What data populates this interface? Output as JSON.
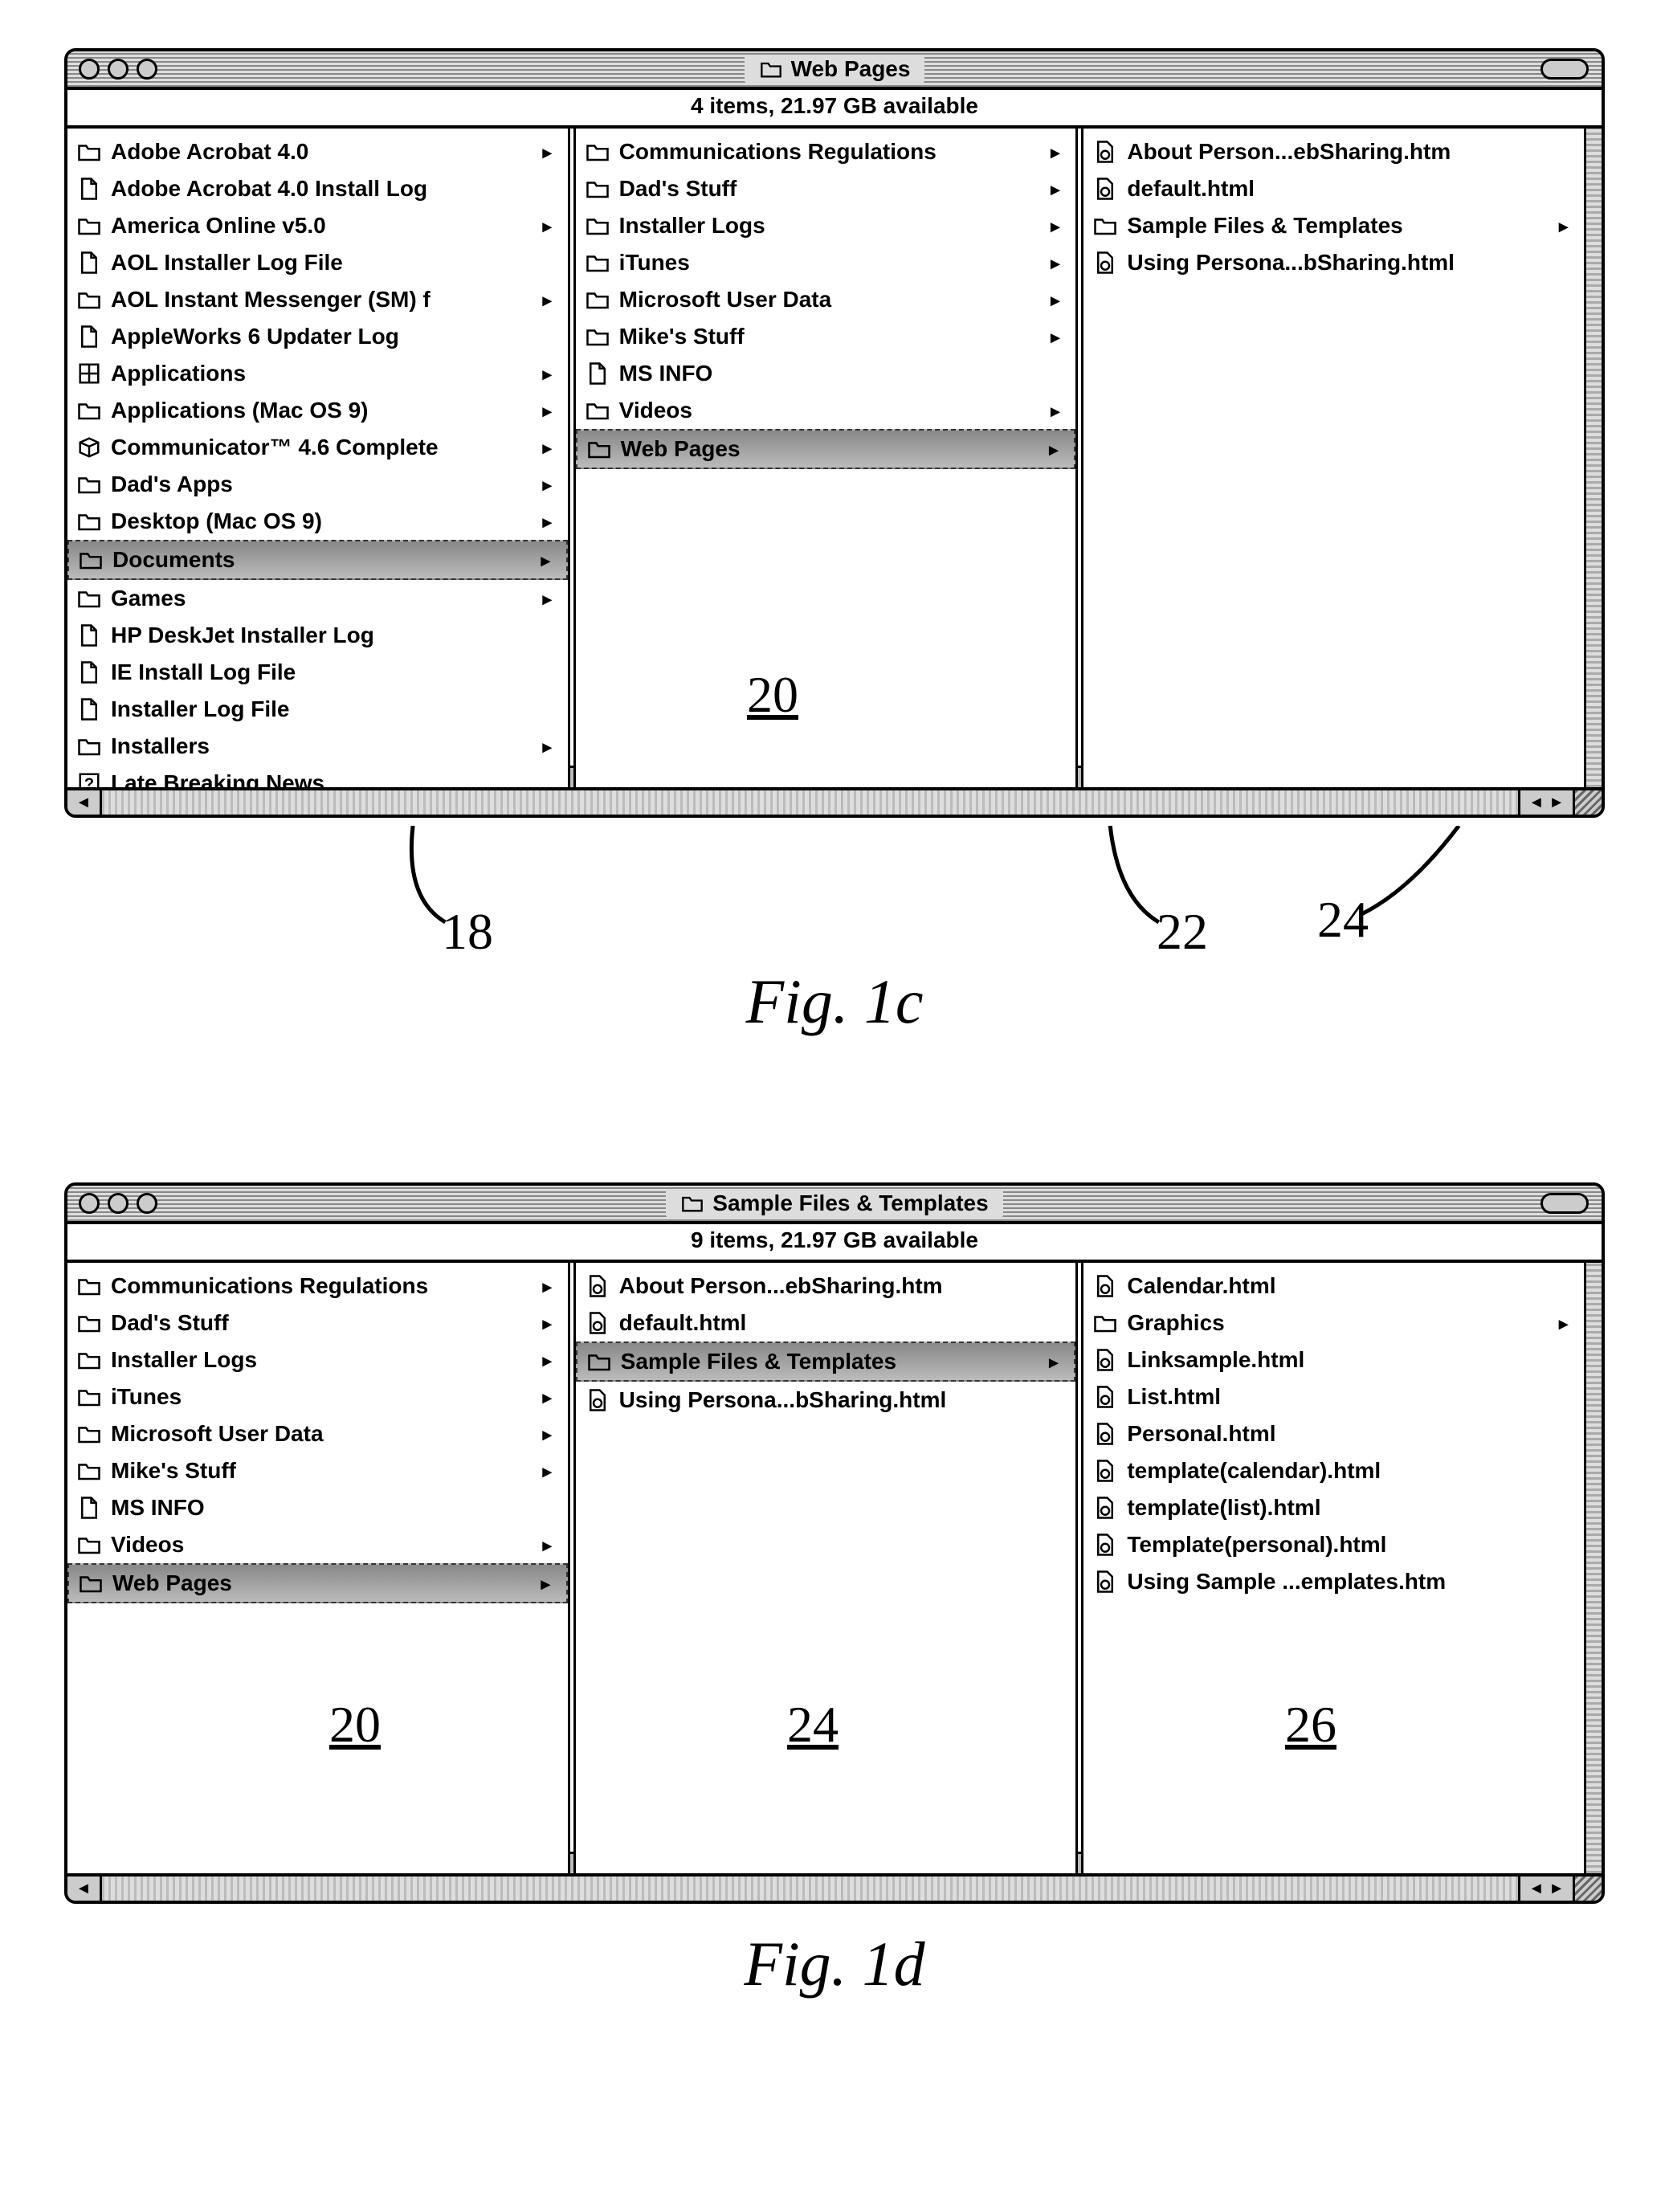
{
  "fig1c": {
    "title": "Web Pages",
    "status": "4 items, 21.97 GB available",
    "caption": "Fig. 1c",
    "callouts": {
      "a": "18",
      "b": "20",
      "c": "22",
      "d": "24"
    },
    "col1": [
      {
        "label": "Adobe Acrobat 4.0",
        "icon": "folder",
        "arrow": true
      },
      {
        "label": "Adobe Acrobat 4.0 Install Log",
        "icon": "doc",
        "arrow": false
      },
      {
        "label": "America Online v5.0",
        "icon": "folder",
        "arrow": true
      },
      {
        "label": "AOL Installer Log File",
        "icon": "doc",
        "arrow": false
      },
      {
        "label": "AOL Instant Messenger (SM) f",
        "icon": "folder",
        "arrow": true
      },
      {
        "label": "AppleWorks 6 Updater Log",
        "icon": "doc",
        "arrow": false
      },
      {
        "label": "Applications",
        "icon": "app",
        "arrow": true
      },
      {
        "label": "Applications (Mac OS 9)",
        "icon": "folder",
        "arrow": true
      },
      {
        "label": "Communicator™ 4.6 Complete",
        "icon": "pkg",
        "arrow": true
      },
      {
        "label": "Dad's Apps",
        "icon": "folder",
        "arrow": true
      },
      {
        "label": "Desktop (Mac OS 9)",
        "icon": "folder",
        "arrow": true
      },
      {
        "label": "Documents",
        "icon": "folder",
        "arrow": true,
        "selected": true
      },
      {
        "label": "Games",
        "icon": "folder",
        "arrow": true
      },
      {
        "label": "HP DeskJet Installer Log",
        "icon": "doc",
        "arrow": false
      },
      {
        "label": "IE Install Log File",
        "icon": "doc",
        "arrow": false
      },
      {
        "label": "Installer Log File",
        "icon": "doc",
        "arrow": false
      },
      {
        "label": "Installers",
        "icon": "folder",
        "arrow": true
      },
      {
        "label": "Late Breaking News",
        "icon": "help",
        "arrow": false
      }
    ],
    "col2": [
      {
        "label": "Communications Regulations",
        "icon": "folder",
        "arrow": true
      },
      {
        "label": "Dad's Stuff",
        "icon": "folder",
        "arrow": true
      },
      {
        "label": "Installer Logs",
        "icon": "folder",
        "arrow": true
      },
      {
        "label": "iTunes",
        "icon": "folder",
        "arrow": true
      },
      {
        "label": "Microsoft User Data",
        "icon": "folder",
        "arrow": true
      },
      {
        "label": "Mike's Stuff",
        "icon": "folder",
        "arrow": true
      },
      {
        "label": "MS INFO",
        "icon": "doc",
        "arrow": false
      },
      {
        "label": "Videos",
        "icon": "folder",
        "arrow": true
      },
      {
        "label": "Web Pages",
        "icon": "folder",
        "arrow": true,
        "selected": true
      }
    ],
    "col3": [
      {
        "label": "About Person...ebSharing.htm",
        "icon": "html",
        "arrow": false
      },
      {
        "label": "default.html",
        "icon": "html",
        "arrow": false
      },
      {
        "label": "Sample Files & Templates",
        "icon": "folder",
        "arrow": true
      },
      {
        "label": "Using Persona...bSharing.html",
        "icon": "html",
        "arrow": false
      }
    ]
  },
  "fig1d": {
    "title": "Sample Files & Templates",
    "status": "9 items, 21.97 GB available",
    "caption": "Fig. 1d",
    "callouts": {
      "a": "20",
      "b": "24",
      "c": "26"
    },
    "col1": [
      {
        "label": "Communications Regulations",
        "icon": "folder",
        "arrow": true
      },
      {
        "label": "Dad's Stuff",
        "icon": "folder",
        "arrow": true
      },
      {
        "label": "Installer Logs",
        "icon": "folder",
        "arrow": true
      },
      {
        "label": "iTunes",
        "icon": "folder",
        "arrow": true
      },
      {
        "label": "Microsoft User Data",
        "icon": "folder",
        "arrow": true
      },
      {
        "label": "Mike's Stuff",
        "icon": "folder",
        "arrow": true
      },
      {
        "label": "MS INFO",
        "icon": "doc",
        "arrow": false
      },
      {
        "label": "Videos",
        "icon": "folder",
        "arrow": true
      },
      {
        "label": "Web Pages",
        "icon": "folder",
        "arrow": true,
        "selected": true
      }
    ],
    "col2": [
      {
        "label": "About Person...ebSharing.htm",
        "icon": "html",
        "arrow": false
      },
      {
        "label": "default.html",
        "icon": "html",
        "arrow": false
      },
      {
        "label": "Sample Files & Templates",
        "icon": "folder",
        "arrow": true,
        "selected": true
      },
      {
        "label": "Using Persona...bSharing.html",
        "icon": "html",
        "arrow": false
      }
    ],
    "col3": [
      {
        "label": "Calendar.html",
        "icon": "html",
        "arrow": false
      },
      {
        "label": "Graphics",
        "icon": "folder",
        "arrow": true
      },
      {
        "label": "Linksample.html",
        "icon": "html",
        "arrow": false
      },
      {
        "label": "List.html",
        "icon": "html",
        "arrow": false
      },
      {
        "label": "Personal.html",
        "icon": "html",
        "arrow": false
      },
      {
        "label": "template(calendar).html",
        "icon": "html",
        "arrow": false
      },
      {
        "label": "template(list).html",
        "icon": "html",
        "arrow": false
      },
      {
        "label": "Template(personal).html",
        "icon": "html",
        "arrow": false
      },
      {
        "label": "Using Sample ...emplates.htm",
        "icon": "html",
        "arrow": false
      }
    ]
  }
}
